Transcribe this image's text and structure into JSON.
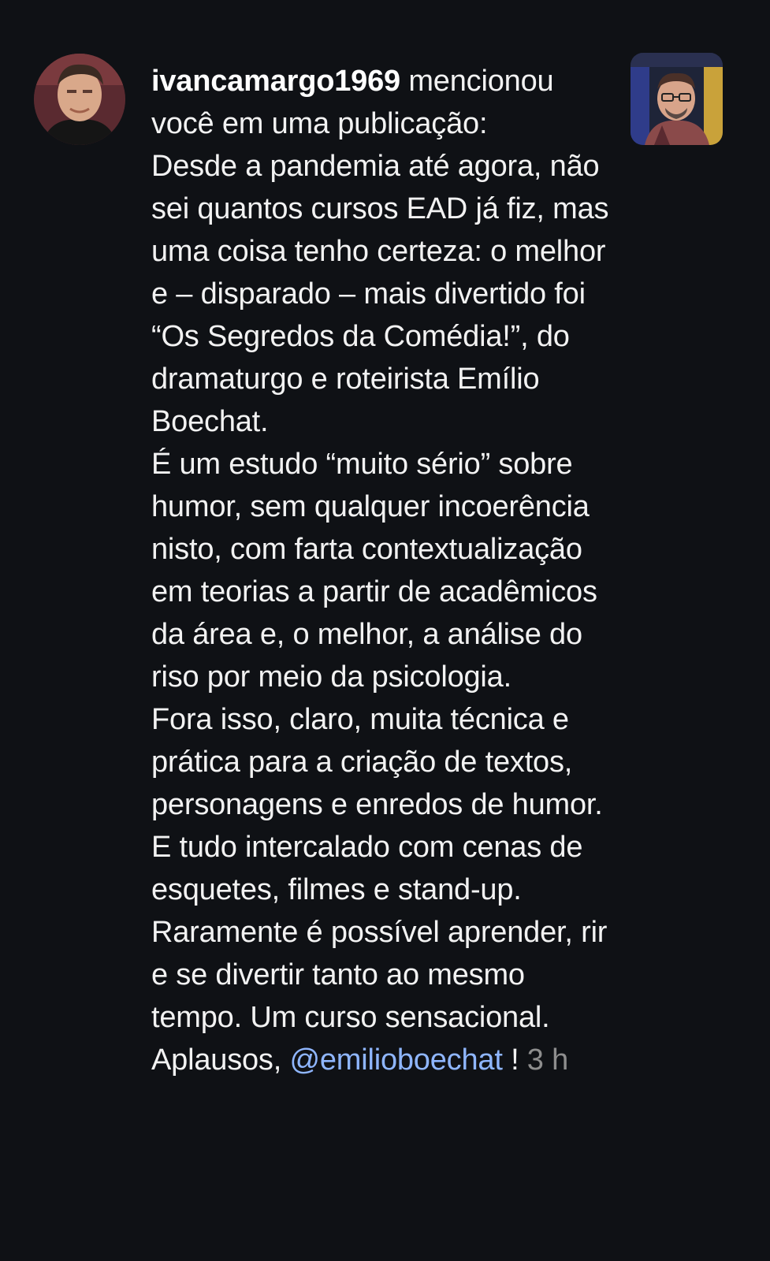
{
  "notification": {
    "username": "ivancamargo1969",
    "action_text": " mencionou você em uma publicação:",
    "paragraphs": [
      "Desde a pandemia até agora, não sei quantos cursos EAD já fiz, mas uma coisa tenho certeza: o melhor e – disparado – mais divertido foi “Os Segredos da Comédia!”, do dramaturgo e roteirista Emílio Boechat.",
      "É um estudo “muito sério” sobre humor, sem qualquer incoerência nisto, com farta contextualização em teorias a partir de acadêmicos da área e, o melhor, a análise do riso por meio da psicologia.",
      "Fora isso, claro, muita técnica e prática para a criação de textos, personagens e enredos de humor. E tudo intercalado com cenas de esquetes, filmes e stand-up.",
      "Raramente é possível aprender, rir e se divertir tanto ao mesmo tempo. Um curso sensacional."
    ],
    "closing_prefix": "Aplausos, ",
    "mention": "@emilioboechat",
    "closing_suffix": " !",
    "timestamp": "3 h"
  },
  "colors": {
    "background": "#0f1115",
    "text": "#f2f2f2",
    "mention": "#8fb6ff",
    "timestamp": "#8e8e8e"
  }
}
